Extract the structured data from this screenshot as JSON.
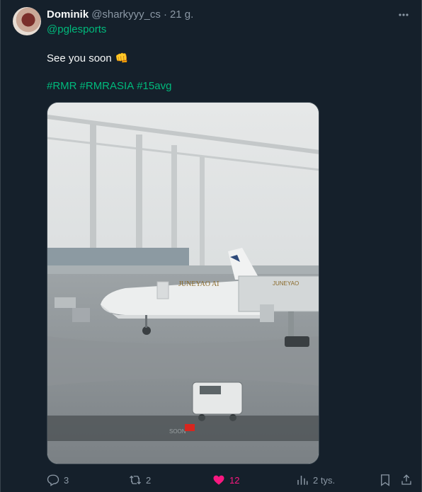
{
  "author": {
    "display_name": "Dominik",
    "handle": "@sharkyyy_cs",
    "separator": "·",
    "time": "21 g."
  },
  "reply_to": "@pglesports",
  "text": "See you soon",
  "emoji": "👊",
  "hashtags": [
    "#RMR",
    "#RMRASIA",
    "#15avg"
  ],
  "media": {
    "airline_text": "JUNEYAO AI",
    "bridge_text": "JUNEYAO",
    "sign_text": "SOON"
  },
  "actions": {
    "replies": "3",
    "reposts": "2",
    "likes": "12",
    "views": "2 tys."
  },
  "colors": {
    "background": "#15202b",
    "hashtag": "#00ba7c",
    "like": "#f91880",
    "muted": "#8b98a5"
  },
  "icons": [
    "more-icon",
    "reply-icon",
    "repost-icon",
    "like-icon",
    "views-icon",
    "bookmark-icon",
    "share-icon"
  ]
}
